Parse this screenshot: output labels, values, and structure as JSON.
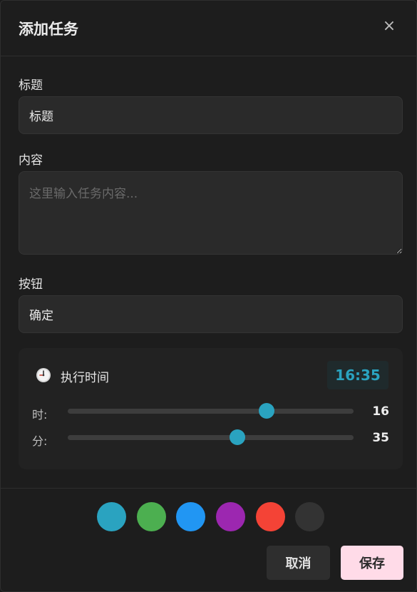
{
  "dialog": {
    "title": "添加任务",
    "close_symbol": "×"
  },
  "fields": {
    "title_label": "标题",
    "title_value": "标题",
    "content_label": "内容",
    "content_placeholder": "这里输入任务内容...",
    "button_label": "按钮",
    "button_value": "确定"
  },
  "time": {
    "icon": "clock-icon",
    "label": "执行时间",
    "display": "16:35",
    "hour_label": "时:",
    "hour_value": "16",
    "minute_label": "分:",
    "minute_value": "35"
  },
  "colors": {
    "accent": "#2aa3c0",
    "swatches": [
      "#2aa3c0",
      "#4caf50",
      "#2196f3",
      "#9c27b0",
      "#f44336",
      "#333333"
    ]
  },
  "actions": {
    "cancel_label": "取消",
    "save_label": "保存"
  }
}
